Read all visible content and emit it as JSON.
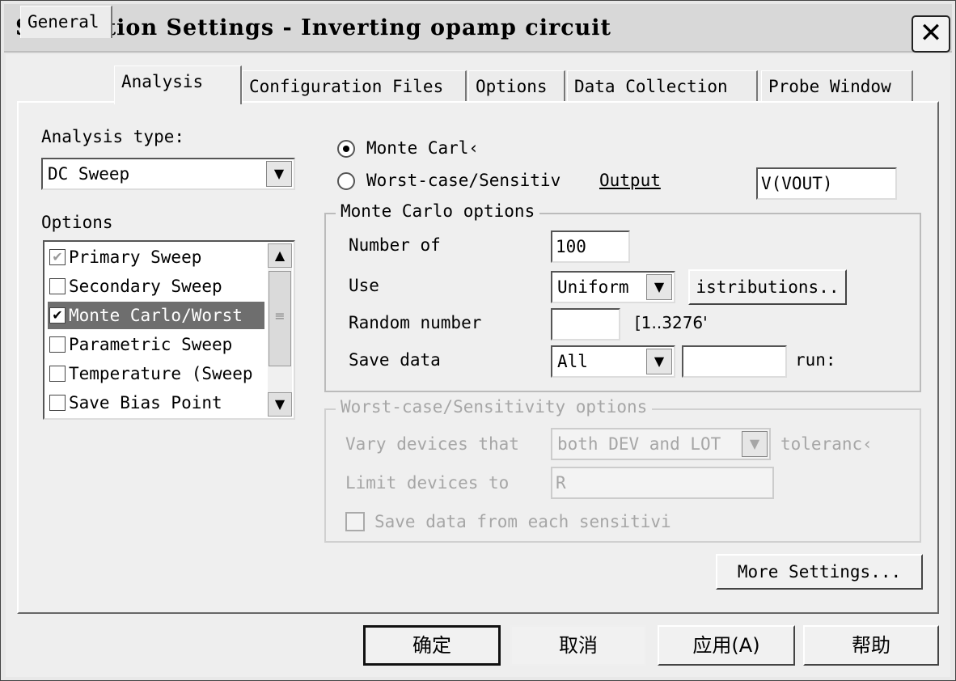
{
  "window": {
    "title": "Simulation Settings - Inverting opamp circuit",
    "close_glyph": "✕"
  },
  "tabs": [
    {
      "label": "General"
    },
    {
      "label": "Analysis"
    },
    {
      "label": "Configuration Files"
    },
    {
      "label": "Options"
    },
    {
      "label": "Data Collection"
    },
    {
      "label": "Probe Window"
    }
  ],
  "analysis_type": {
    "label": "Analysis type:",
    "value": "DC Sweep"
  },
  "options": {
    "label": "Options",
    "items": [
      {
        "label": "Primary Sweep",
        "mark": "✔"
      },
      {
        "label": "Secondary Sweep",
        "mark": ""
      },
      {
        "label": "Monte Carlo/Worst",
        "mark": "✔"
      },
      {
        "label": "Parametric Sweep",
        "mark": ""
      },
      {
        "label": "Temperature (Sweep",
        "mark": ""
      },
      {
        "label": "Save Bias Point",
        "mark": ""
      }
    ]
  },
  "mode": {
    "monte_carlo_label": "Monte Carl‹",
    "worst_case_label": "Worst-case/Sensitiv",
    "output_label": "Output",
    "output_value": "V(VOUT)"
  },
  "monte_carlo": {
    "legend": "Monte Carlo options",
    "number_label": "Number of",
    "number_value": "100",
    "use_label": "Use",
    "use_value": "Uniform",
    "distributions_button": "istributions..",
    "seed_label": "Random number",
    "seed_value": "",
    "seed_range": "[1..3276'",
    "save_label": "Save data",
    "save_value": "All",
    "runs_value": "",
    "runs_label": "run:"
  },
  "worst_case": {
    "legend": "Worst-case/Sensitivity options",
    "vary_label": "Vary devices that",
    "vary_value": "both DEV and LOT",
    "tolerance_label": "toleranc‹",
    "limit_label": "Limit devices to",
    "limit_value": "R",
    "save_each_label": "Save data from each sensitivi"
  },
  "more_settings_button": "More Settings...",
  "footer": {
    "ok": "确定",
    "cancel": "取消",
    "apply": "应用(A)",
    "help": "帮助"
  }
}
